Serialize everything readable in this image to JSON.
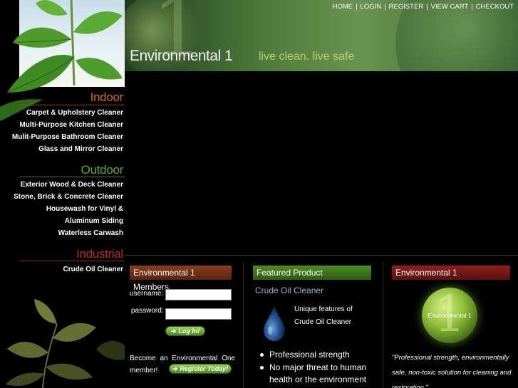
{
  "site": {
    "brand": "Environmental 1",
    "tagline": "live clean. live safe",
    "brand_numeral": "1"
  },
  "topnav": [
    "HOME",
    "LOGIN",
    "REGISTER",
    "VIEW CART",
    "CHECKOUT"
  ],
  "sidebar": {
    "sections": [
      {
        "heading": "Indoor",
        "color": "#d2691e",
        "items": [
          "Carpet & Upholstery Cleaner",
          "Multi-Purpose Kitchen Cleaner",
          "Mulit-Purpose Bathroom Cleaner",
          "Glass and Mirror Cleaner"
        ]
      },
      {
        "heading": "Outdoor",
        "color": "#6aa52a",
        "items": [
          "Exterior Wood & Deck Cleaner",
          "Stone, Brick & Concrete Cleaner",
          "Housewash for Vinyl &",
          "Aluminum Siding",
          "Waterless Carwash"
        ]
      },
      {
        "heading": "Industrial",
        "color": "#c02a22",
        "items": [
          "Crude Oil Cleaner"
        ]
      }
    ]
  },
  "members": {
    "title": "Environmental 1 Members",
    "username_label": "username:",
    "password_label": "password:",
    "login_label": "Log In!",
    "join_text": "Become an Environmental One member!",
    "register_label": "Register Today!"
  },
  "featured": {
    "title": "Featured Product",
    "product_name": "Crude Oil Cleaner",
    "description": "Unique features of Crude Oil Cleaner",
    "bullets": [
      "Professional strength",
      "No major threat to human health or the environment"
    ]
  },
  "about": {
    "title": "Environmental 1",
    "orb_label": "Environmental 1",
    "orb_numeral": "1",
    "quote": "\"Professional strength, environmentally safe, non-toxic solution for cleaning and restoration.\""
  }
}
